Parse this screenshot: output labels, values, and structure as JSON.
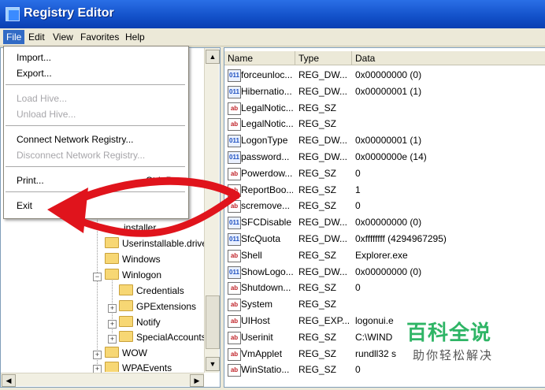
{
  "window": {
    "title": "Registry Editor"
  },
  "menubar": [
    "File",
    "Edit",
    "View",
    "Favorites",
    "Help"
  ],
  "file_menu": {
    "import": "Import...",
    "export": "Export...",
    "load_hive": "Load Hive...",
    "unload_hive": "Unload Hive...",
    "connect": "Connect Network Registry...",
    "disconnect": "Disconnect Network Registry...",
    "print": "Print...",
    "print_shortcut": "Ctrl+P",
    "exit": "Exit"
  },
  "tree": {
    "items": [
      {
        "label": "...installer"
      },
      {
        "label": "Userinstallable.drivers"
      },
      {
        "label": "Windows"
      },
      {
        "label": "Winlogon"
      },
      {
        "label": "Credentials"
      },
      {
        "label": "GPExtensions"
      },
      {
        "label": "Notify"
      },
      {
        "label": "SpecialAccounts"
      },
      {
        "label": "WOW"
      },
      {
        "label": "WPAEvents"
      }
    ]
  },
  "list": {
    "headers": {
      "name": "Name",
      "type": "Type",
      "data": "Data"
    },
    "rows": [
      {
        "icon": "dword-icon",
        "name": "forceunloc...",
        "type": "REG_DW...",
        "data": "0x00000000 (0)"
      },
      {
        "icon": "dword-icon",
        "name": "Hibernatio...",
        "type": "REG_DW...",
        "data": "0x00000001 (1)"
      },
      {
        "icon": "string-icon",
        "name": "LegalNotic...",
        "type": "REG_SZ",
        "data": ""
      },
      {
        "icon": "string-icon",
        "name": "LegalNotic...",
        "type": "REG_SZ",
        "data": ""
      },
      {
        "icon": "dword-icon",
        "name": "LogonType",
        "type": "REG_DW...",
        "data": "0x00000001 (1)"
      },
      {
        "icon": "dword-icon",
        "name": "password...",
        "type": "REG_DW...",
        "data": "0x0000000e (14)"
      },
      {
        "icon": "string-icon",
        "name": "Powerdow...",
        "type": "REG_SZ",
        "data": "0"
      },
      {
        "icon": "string-icon",
        "name": "ReportBoo...",
        "type": "REG_SZ",
        "data": "1"
      },
      {
        "icon": "string-icon",
        "name": "scremove...",
        "type": "REG_SZ",
        "data": "0"
      },
      {
        "icon": "dword-icon",
        "name": "SFCDisable",
        "type": "REG_DW...",
        "data": "0x00000000 (0)"
      },
      {
        "icon": "dword-icon",
        "name": "SfcQuota",
        "type": "REG_DW...",
        "data": "0xffffffff (4294967295)"
      },
      {
        "icon": "string-icon",
        "name": "Shell",
        "type": "REG_SZ",
        "data": "Explorer.exe"
      },
      {
        "icon": "dword-icon",
        "name": "ShowLogo...",
        "type": "REG_DW...",
        "data": "0x00000000 (0)"
      },
      {
        "icon": "string-icon",
        "name": "Shutdown...",
        "type": "REG_SZ",
        "data": "0"
      },
      {
        "icon": "string-icon",
        "name": "System",
        "type": "REG_SZ",
        "data": ""
      },
      {
        "icon": "string-icon",
        "name": "UIHost",
        "type": "REG_EXP...",
        "data": "logonui.e"
      },
      {
        "icon": "string-icon",
        "name": "Userinit",
        "type": "REG_SZ",
        "data": "C:\\WIND"
      },
      {
        "icon": "string-icon",
        "name": "VmApplet",
        "type": "REG_SZ",
        "data": "rundll32 s"
      },
      {
        "icon": "string-icon",
        "name": "WinStatio...",
        "type": "REG_SZ",
        "data": "0"
      }
    ]
  },
  "watermark": {
    "main": "百科全说",
    "sub": "助你轻松解决"
  },
  "colors": {
    "menu_highlight": "#316ac5",
    "arrow": "#e0141c",
    "watermark": "#2fb566"
  }
}
